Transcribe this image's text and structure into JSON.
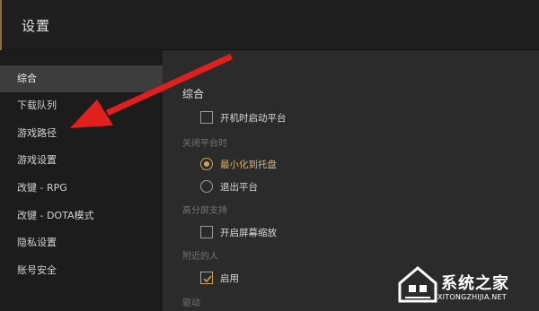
{
  "window": {
    "title": "设置"
  },
  "sidebar": {
    "items": [
      {
        "label": "综合",
        "active": true
      },
      {
        "label": "下载队列"
      },
      {
        "label": "游戏路径"
      },
      {
        "label": "游戏设置"
      },
      {
        "label": "改键 - RPG"
      },
      {
        "label": "改键 - DOTA模式"
      },
      {
        "label": "隐私设置"
      },
      {
        "label": "账号安全"
      }
    ]
  },
  "main": {
    "heading": "综合",
    "startup": {
      "label": "开机时启动平台",
      "checked": false
    },
    "close_group": {
      "label": "关闭平台时",
      "options": [
        {
          "label": "最小化到托盘",
          "selected": true
        },
        {
          "label": "退出平台",
          "selected": false
        }
      ]
    },
    "hidpi_group": {
      "label": "高分屏支持",
      "option": {
        "label": "开启屏幕缩放",
        "checked": false
      }
    },
    "nearby_group": {
      "label": "附近的人",
      "option": {
        "label": "启用",
        "checked": true
      }
    },
    "driver_group": {
      "label": "驱动"
    }
  },
  "annotation": {
    "color": "#e0201c",
    "icon": "red-arrow"
  },
  "watermark": {
    "name": "系统之家",
    "url": "XITONGZHIJIA.NET",
    "icon": "house-logo-icon"
  },
  "colors": {
    "accent": "#c9a35c",
    "sidebar_bg": "#1c1c1c",
    "main_bg": "#2b2b2b",
    "active_item_bg": "#3d3d3d"
  }
}
